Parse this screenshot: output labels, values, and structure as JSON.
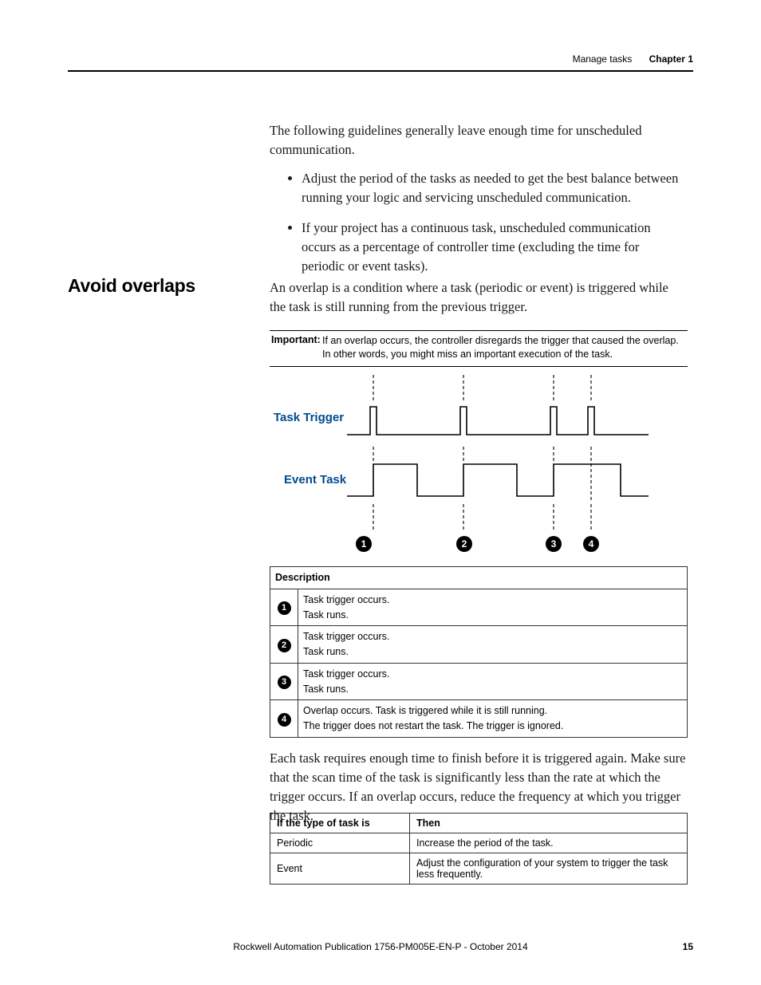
{
  "header": {
    "section": "Manage tasks",
    "chapter": "Chapter 1"
  },
  "intro": "The following guidelines generally leave enough time for unscheduled communication.",
  "bullets": [
    "Adjust the period of the tasks as needed to get the best balance between running your logic and servicing unscheduled communication.",
    "If your project has a continuous task, unscheduled communication occurs as a percentage of controller time (excluding the time for periodic or event tasks)."
  ],
  "side_heading": "Avoid overlaps",
  "overlap_intro": "An overlap is a condition where a task (periodic or event) is triggered while the task is still running from the previous trigger.",
  "important": {
    "label": "Important:",
    "text": "If an overlap occurs, the controller disregards the trigger that caused the overlap. In other words, you might miss an important execution of the task."
  },
  "diagram": {
    "label_trigger": "Task Trigger",
    "label_event": "Event Task"
  },
  "desc_table": {
    "header": "Description",
    "rows": [
      {
        "num": "1",
        "line1": "Task trigger occurs.",
        "line2": "Task runs."
      },
      {
        "num": "2",
        "line1": "Task trigger occurs.",
        "line2": "Task runs."
      },
      {
        "num": "3",
        "line1": "Task trigger occurs.",
        "line2": "Task runs."
      },
      {
        "num": "4",
        "line1": "Overlap occurs. Task is triggered while it is still running.",
        "line2": "The trigger does not restart the task. The trigger is ignored."
      }
    ]
  },
  "after_desc": "Each task requires enough time to finish before it is triggered again. Make sure that the scan time of the task is significantly less than the rate at which the trigger occurs. If an overlap occurs, reduce the frequency at which you trigger the task.",
  "type_table": {
    "col1": "If the type of task is",
    "col2": "Then",
    "rows": [
      {
        "a": "Periodic",
        "b": "Increase the period of the task."
      },
      {
        "a": "Event",
        "b": "Adjust the configuration of your system to trigger the task less frequently."
      }
    ]
  },
  "footer": {
    "publication": "Rockwell Automation Publication 1756-PM005E-EN-P - October 2014",
    "page": "15"
  }
}
